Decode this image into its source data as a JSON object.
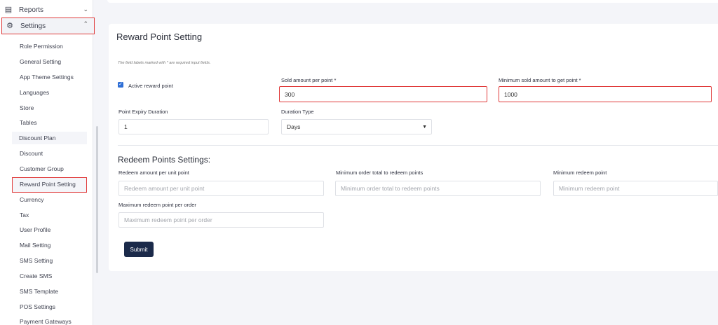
{
  "sidebar": {
    "reports_label": "Reports",
    "settings_label": "Settings",
    "items": [
      "Role Permission",
      "General Setting",
      "App Theme Settings",
      "Languages",
      "Store",
      "Tables",
      "Discount Plan",
      "Discount",
      "Customer Group",
      "Reward Point Setting",
      "Currency",
      "Tax",
      "User Profile",
      "Mail Setting",
      "SMS Setting",
      "Create SMS",
      "SMS Template",
      "POS Settings",
      "Payment Gateways"
    ]
  },
  "form": {
    "title": "Reward Point Setting",
    "note": "The field labels marked with * are required input fields.",
    "active_label": "Active reward point",
    "sold_amount_label": "Sold amount per point *",
    "sold_amount_value": "300",
    "min_sold_label": "Minimum sold amount to get point *",
    "min_sold_value": "1000",
    "expiry_label": "Point Expiry Duration",
    "expiry_value": "1",
    "duration_type_label": "Duration Type",
    "duration_type_value": "Days"
  },
  "redeem": {
    "title": "Redeem Points Settings:",
    "amount_label": "Redeem amount per unit point",
    "amount_placeholder": "Redeem amount per unit point",
    "min_order_label": "Minimum order total to redeem points",
    "min_order_placeholder": "Minimum order total to redeem points",
    "min_redeem_label": "Minimum redeem point",
    "min_redeem_placeholder": "Minimum redeem point",
    "max_redeem_label": "Maximum redeem point per order",
    "max_redeem_placeholder": "Maximum redeem point per order"
  },
  "submit_label": "Submit",
  "colors": {
    "highlight": "#e03b3b",
    "button": "#1b2a4a",
    "checkbox": "#2f6fd6"
  }
}
